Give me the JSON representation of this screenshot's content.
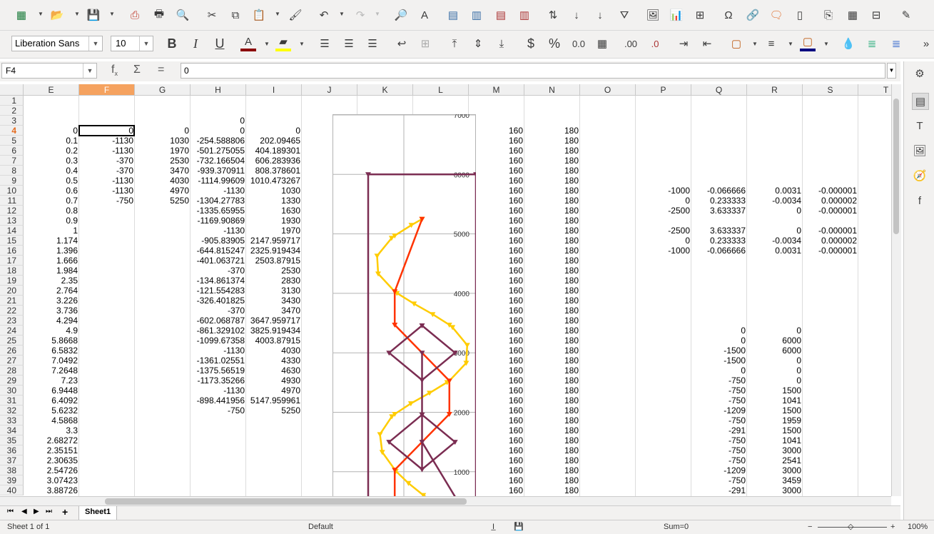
{
  "toolbar": {
    "font_name": "Liberation Sans",
    "font_size": "10"
  },
  "formula_bar": {
    "cell_ref": "F4",
    "value": "0"
  },
  "columns": [
    "E",
    "F",
    "G",
    "H",
    "I",
    "J",
    "K",
    "L",
    "M",
    "N",
    "O",
    "P",
    "Q",
    "R",
    "S",
    "T"
  ],
  "selected_column": "F",
  "rows": [
    "1",
    "2",
    "3",
    "4",
    "5",
    "6",
    "7",
    "8",
    "9",
    "10",
    "11",
    "12",
    "13",
    "14",
    "15",
    "16",
    "17",
    "18",
    "19",
    "20",
    "21",
    "22",
    "23",
    "24",
    "25",
    "26",
    "27",
    "28",
    "29",
    "30",
    "31",
    "32",
    "33",
    "34",
    "35",
    "36",
    "37",
    "38",
    "39",
    "40"
  ],
  "selected_row": "4",
  "colE": [
    "",
    "",
    "",
    "0",
    "0.1",
    "0.2",
    "0.3",
    "0.4",
    "0.5",
    "0.6",
    "0.7",
    "0.8",
    "0.9",
    "1",
    "1.174",
    "1.396",
    "1.666",
    "1.984",
    "2.35",
    "2.764",
    "3.226",
    "3.736",
    "4.294",
    "4.9",
    "5.8668",
    "6.5832",
    "7.0492",
    "7.2648",
    "7.23",
    "6.9448",
    "6.4092",
    "5.6232",
    "4.5868",
    "3.3",
    "2.68272",
    "2.35151",
    "2.30635",
    "2.54726",
    "3.07423",
    "3.88726"
  ],
  "colF": [
    "",
    "",
    "",
    "0",
    "-1130",
    "-1130",
    "-370",
    "-370",
    "-1130",
    "-1130",
    "-750",
    "",
    "",
    "",
    "",
    "",
    "",
    "",
    "",
    "",
    "",
    "",
    "",
    "",
    "",
    "",
    "",
    "",
    "",
    "",
    "",
    "",
    "",
    "",
    "",
    "",
    "",
    "",
    "",
    ""
  ],
  "colG": [
    "",
    "",
    "",
    "0",
    "1030",
    "1970",
    "2530",
    "3470",
    "4030",
    "4970",
    "5250",
    "",
    "",
    "",
    "",
    "",
    "",
    "",
    "",
    "",
    "",
    "",
    "",
    "",
    "",
    "",
    "",
    "",
    "",
    "",
    "",
    "",
    "",
    "",
    "",
    "",
    "",
    "",
    "",
    ""
  ],
  "colH": [
    "",
    "",
    "0",
    "0",
    "-254.588806",
    "-501.275055",
    "-732.166504",
    "-939.370911",
    "-1114.99609",
    "-1130",
    "-1304.27783",
    "-1335.65955",
    "-1169.90869",
    "-1130",
    "-905.83905",
    "-644.815247",
    "-401.063721",
    "-370",
    "-134.861374",
    "-121.554283",
    "-326.401825",
    "-370",
    "-602.068787",
    "-861.329102",
    "-1099.67358",
    "-1130",
    "-1361.02551",
    "-1375.56519",
    "-1173.35266",
    "-1130",
    "-898.441956",
    "-750",
    "",
    "",
    "",
    "",
    "",
    "",
    "",
    ""
  ],
  "colI": [
    "",
    "",
    "",
    "0",
    "202.09465",
    "404.189301",
    "606.283936",
    "808.378601",
    "1010.473267",
    "1030",
    "1330",
    "1630",
    "1930",
    "1970",
    "2147.959717",
    "2325.919434",
    "2503.87915",
    "2530",
    "2830",
    "3130",
    "3430",
    "3470",
    "3647.959717",
    "3825.919434",
    "4003.87915",
    "4030",
    "4330",
    "4630",
    "4930",
    "4970",
    "5147.959961",
    "5250",
    "",
    "",
    "",
    "",
    "",
    "",
    "",
    ""
  ],
  "colM": [
    "",
    "",
    "",
    "160",
    "160",
    "160",
    "160",
    "160",
    "160",
    "160",
    "160",
    "160",
    "160",
    "160",
    "160",
    "160",
    "160",
    "160",
    "160",
    "160",
    "160",
    "160",
    "160",
    "160",
    "160",
    "160",
    "160",
    "160",
    "160",
    "160",
    "160",
    "160",
    "160",
    "160",
    "160",
    "160",
    "160",
    "160",
    "160",
    "160"
  ],
  "colN": [
    "",
    "",
    "",
    "180",
    "180",
    "180",
    "180",
    "180",
    "180",
    "180",
    "180",
    "180",
    "180",
    "180",
    "180",
    "180",
    "180",
    "180",
    "180",
    "180",
    "180",
    "180",
    "180",
    "180",
    "180",
    "180",
    "180",
    "180",
    "180",
    "180",
    "180",
    "180",
    "180",
    "180",
    "180",
    "180",
    "180",
    "180",
    "180",
    "180"
  ],
  "colP": [
    "",
    "",
    "",
    "",
    "",
    "",
    "",
    "",
    "",
    "-1000",
    "0",
    "-2500",
    "",
    "-2500",
    "0",
    "-1000",
    "",
    "",
    "",
    "",
    "",
    "",
    "",
    "",
    "",
    "",
    "",
    "",
    "",
    "",
    "",
    "",
    "",
    "",
    "",
    "",
    "",
    "",
    "",
    ""
  ],
  "colQ": [
    "",
    "",
    "",
    "",
    "",
    "",
    "",
    "",
    "",
    "-0.066666",
    "0.233333",
    "3.633337",
    "",
    "3.633337",
    "0.233333",
    "-0.066666",
    "",
    "",
    "",
    "",
    "",
    "",
    "",
    "0",
    "0",
    "-1500",
    "-1500",
    "0",
    "-750",
    "-750",
    "-750",
    "-1209",
    "-750",
    "-291",
    "-750",
    "-750",
    "-750",
    "-1209",
    "-750",
    "-291"
  ],
  "colR": [
    "",
    "",
    "",
    "",
    "",
    "",
    "",
    "",
    "",
    "0.0031",
    "-0.0034",
    "0",
    "",
    "0",
    "-0.0034",
    "0.0031",
    "",
    "",
    "",
    "",
    "",
    "",
    "",
    "0",
    "6000",
    "6000",
    "0",
    "0",
    "0",
    "1500",
    "1041",
    "1500",
    "1959",
    "1500",
    "1041",
    "3000",
    "2541",
    "3000",
    "3459",
    "3000"
  ],
  "colS": [
    "",
    "",
    "",
    "",
    "",
    "",
    "",
    "",
    "",
    "-0.000001",
    "0.000002",
    "-0.000001",
    "",
    "-0.000001",
    "0.000002",
    "-0.000001",
    "",
    "",
    "",
    "",
    "",
    "",
    "",
    "",
    "",
    "",
    "",
    "",
    "",
    "",
    "",
    "",
    "",
    "",
    "",
    "",
    "",
    "",
    "",
    ""
  ],
  "chart_data": {
    "type": "line",
    "y_ticks": [
      "7000",
      "6000",
      "5000",
      "4000",
      "3000",
      "2000",
      "1000"
    ],
    "ylim": [
      0,
      7000
    ],
    "xlim": [
      -1500,
      0
    ],
    "series": [
      {
        "color": "#ffcc00",
        "x": [
          0,
          -254.588806,
          -501.275055,
          -732.166504,
          -939.370911,
          -1114.99609,
          -1304.27783,
          -1335.65955,
          -1169.90869,
          -1130,
          -905.83905,
          -644.815247,
          -401.063721,
          -370,
          -134.861374,
          -121.554283,
          -326.401825,
          -370,
          -602.068787,
          -861.329102,
          -1099.67358,
          -1130,
          -1361.02551,
          -1375.56519,
          -1173.35266,
          -1130,
          -898.441956,
          -750
        ],
        "y": [
          0,
          202.09465,
          404.189301,
          606.283936,
          808.378601,
          1010.473267,
          1330,
          1630,
          1930,
          1970,
          2147.959717,
          2325.919434,
          2503.87915,
          2530,
          2830,
          3130,
          3430,
          3470,
          3647.959717,
          3825.919434,
          4003.87915,
          4030,
          4330,
          4630,
          4930,
          4970,
          5147.959961,
          5250
        ]
      },
      {
        "color": "#ff3300",
        "x": [
          -1130,
          -1130,
          -370,
          -370,
          -1130,
          -1130,
          -750
        ],
        "y": [
          0,
          1030,
          1970,
          2530,
          3470,
          4030,
          5250
        ]
      },
      {
        "color": "#7b2d52",
        "x": [
          0,
          0,
          -1500,
          -1500,
          0,
          0,
          -750,
          -750,
          -1209,
          -750,
          -291,
          -750,
          -750,
          -750,
          -1209,
          -750,
          -291,
          -750
        ],
        "y": [
          0,
          6000,
          6000,
          0,
          0,
          0,
          1500,
          1041,
          1500,
          1959,
          1500,
          1041,
          3000,
          2541,
          3000,
          3459,
          3000,
          2541
        ]
      }
    ]
  },
  "sheet_tab": "Sheet1",
  "status": {
    "sheet": "Sheet 1 of 1",
    "style": "Default",
    "sum": "Sum=0",
    "zoom": "100%"
  }
}
